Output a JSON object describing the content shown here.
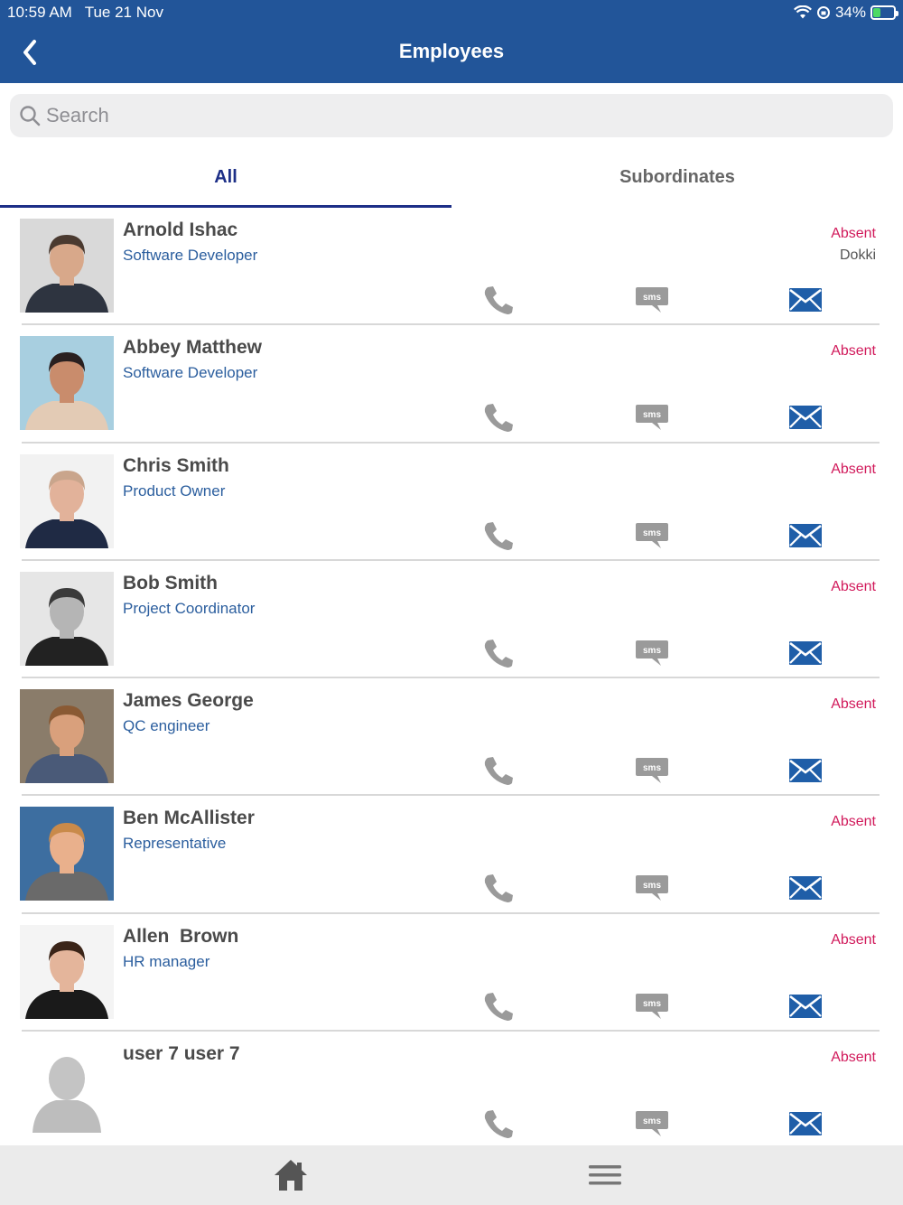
{
  "status_bar": {
    "time": "10:59 AM",
    "date": "Tue 21 Nov",
    "battery": "34%",
    "icons": [
      "wifi-icon",
      "rotation-lock-icon",
      "battery-charging-icon"
    ]
  },
  "header": {
    "title": "Employees",
    "back_icon": "chevron-left-icon",
    "background": "#225599"
  },
  "search": {
    "placeholder": "Search",
    "value": ""
  },
  "tabs": [
    {
      "label": "All",
      "active": true
    },
    {
      "label": "Subordinates",
      "active": false
    }
  ],
  "colors": {
    "accent": "#1d2f87",
    "status_absent": "#d11a5b",
    "role_text": "#2b5e9e",
    "icon_blue": "#1f5ea8",
    "icon_grey": "#9a9a9a"
  },
  "employees": [
    {
      "name": "Arnold Ishac",
      "role": "Software Developer",
      "status": "Absent",
      "location": "Dokki"
    },
    {
      "name": "Abbey Matthew",
      "role": "Software Developer",
      "status": "Absent",
      "location": ""
    },
    {
      "name": "Chris Smith",
      "role": "Product Owner",
      "status": "Absent",
      "location": ""
    },
    {
      "name": "Bob Smith",
      "role": "Project Coordinator",
      "status": "Absent",
      "location": ""
    },
    {
      "name": "James George",
      "role": "QC engineer",
      "status": "Absent",
      "location": ""
    },
    {
      "name": "Ben McAllister",
      "role": "Representative",
      "status": "Absent",
      "location": ""
    },
    {
      "name": "Allen  Brown",
      "role": "HR manager",
      "status": "Absent",
      "location": ""
    },
    {
      "name": "user 7 user 7",
      "role": "",
      "status": "Absent",
      "location": ""
    }
  ],
  "row_actions": {
    "sms_label": "sms",
    "icons": [
      "phone-icon",
      "sms-icon",
      "mail-icon"
    ]
  },
  "tabbar": {
    "icons": [
      "home-icon",
      "hamburger-menu-icon"
    ]
  }
}
